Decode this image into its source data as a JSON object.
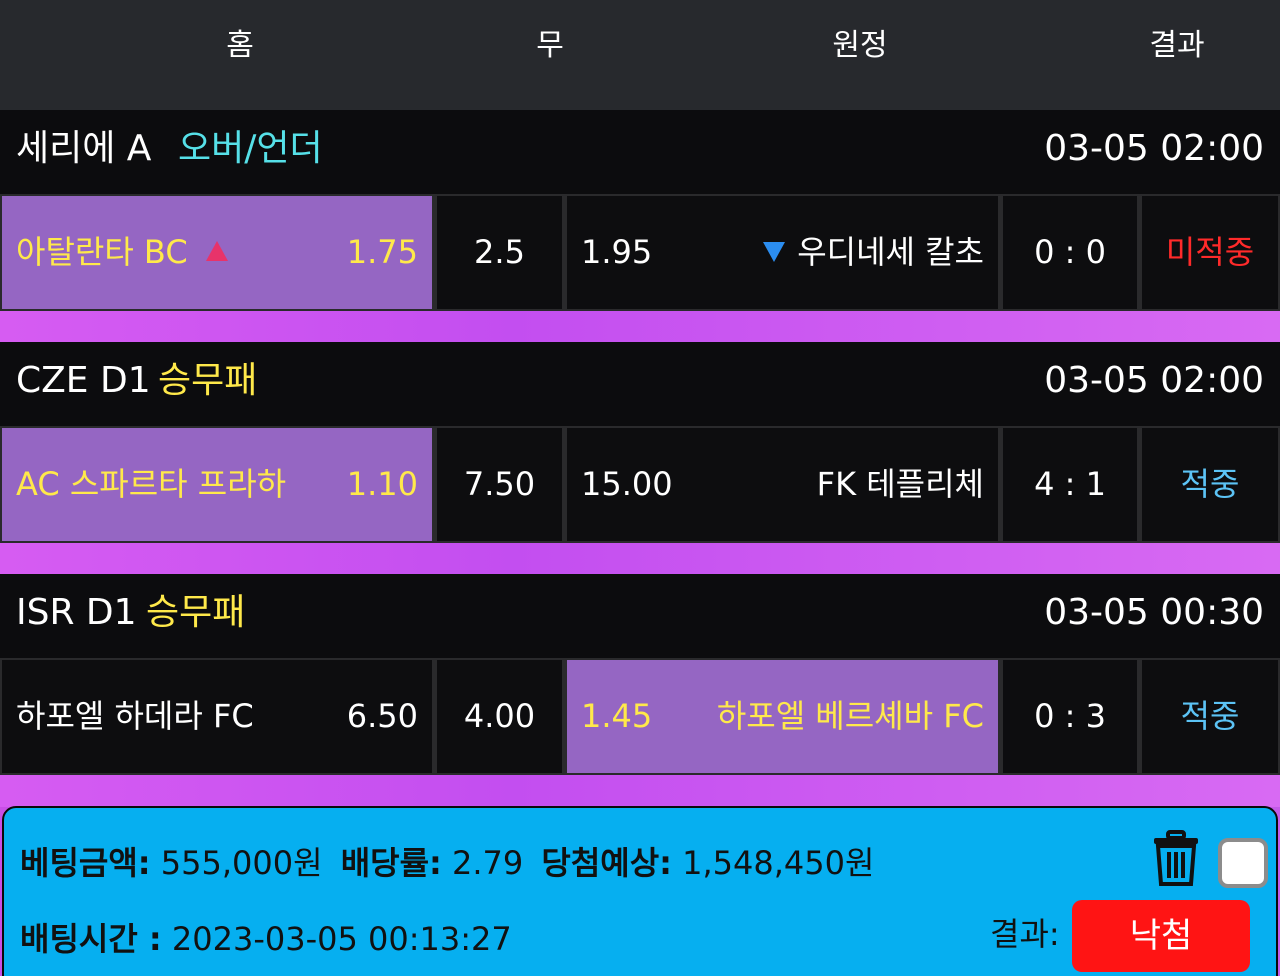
{
  "header": {
    "home": "홈",
    "draw": "무",
    "away": "원정",
    "result": "결과"
  },
  "matches": [
    {
      "league": "세리에 A",
      "bet_type": "오버/언더",
      "bet_type_color": "#56e0e8",
      "time": "03-05 02:00",
      "home_team": "아탈란타 BC",
      "home_icon": "up-triangle-icon",
      "home_odds": "1.75",
      "draw_odds": "2.5",
      "away_odds": "1.95",
      "away_icon": "down-triangle-icon",
      "away_team": "우디네세 칼초",
      "score": "0 : 0",
      "result": "미적중",
      "selected": "home"
    },
    {
      "league": "CZE D1",
      "bet_type": "승무패",
      "bet_type_color": "#ffe94a",
      "time": "03-05 02:00",
      "home_team": "AC 스파르타 프라하",
      "home_odds": "1.10",
      "draw_odds": "7.50",
      "away_odds": "15.00",
      "away_team": "FK 테플리체",
      "score": "4 : 1",
      "result": "적중",
      "selected": "home"
    },
    {
      "league": "ISR D1",
      "bet_type": "승무패",
      "bet_type_color": "#ffe94a",
      "time": "03-05 00:30",
      "home_team": "하포엘 하데라 FC",
      "home_odds": "6.50",
      "draw_odds": "4.00",
      "away_odds": "1.45",
      "away_team": "하포엘 베르셰바 FC",
      "score": "0 : 3",
      "result": "적중",
      "selected": "away"
    }
  ],
  "footer": {
    "bet_amount_label": "베팅금액:",
    "bet_amount": "555,000원",
    "odds_label": "배당률:",
    "odds": "2.79",
    "expected_label": "당첨예상:",
    "expected": "1,548,450원",
    "bet_time_label": "배팅시간 :",
    "bet_time": "2023-03-05 00:13:27",
    "result_label": "결과:",
    "result_button": "낙첨"
  },
  "colors": {
    "header_bg": "#27292d",
    "selected_cell": "#9566c3",
    "selected_text": "#ffe94a",
    "miss": "#ff2a2a",
    "hit": "#5cc3f5",
    "footer_bg": "#06aff0",
    "result_button": "#ff1414"
  }
}
